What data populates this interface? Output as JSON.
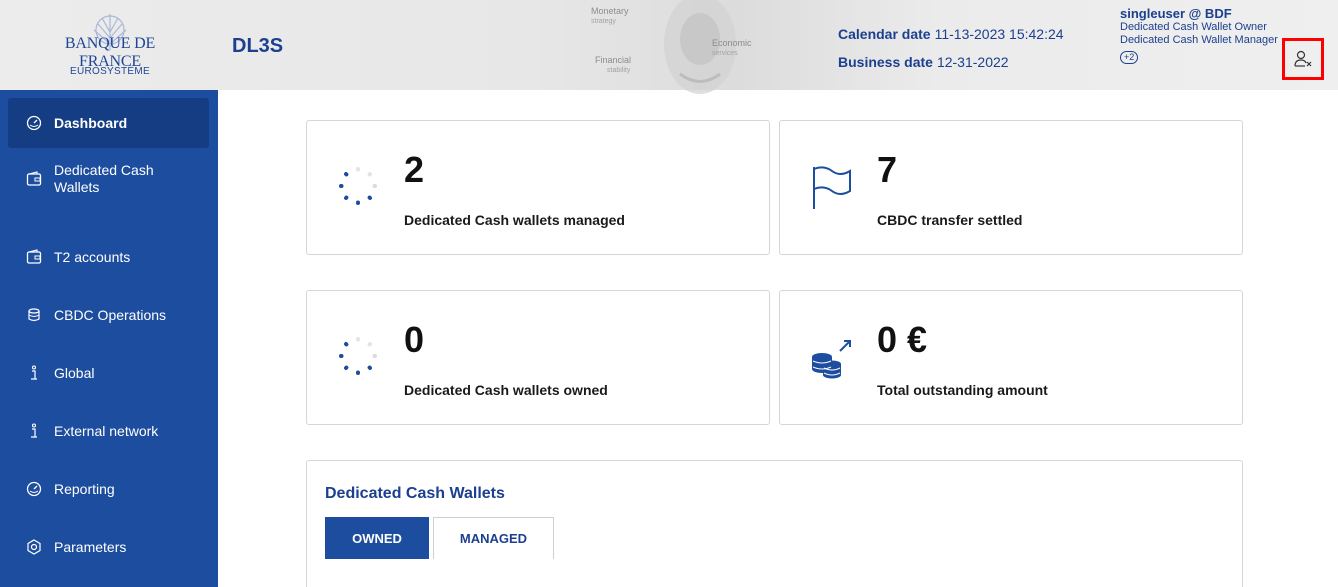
{
  "header": {
    "logo_main": "BANQUE DE FRANCE",
    "logo_sub": "EUROSYSTÈME",
    "app_name": "DL3S",
    "medallion": {
      "monetary": "Monetary",
      "strategy": "strategy",
      "economic": "Economic",
      "services": "services",
      "financial": "Financial",
      "stability": "stability"
    },
    "calendar_label": "Calendar date",
    "calendar_value": "11-13-2023 15:42:24",
    "business_label": "Business date",
    "business_value": "12-31-2022",
    "user": {
      "name": "singleuser @ BDF",
      "roles": [
        "Dedicated Cash Wallet Owner",
        "Dedicated Cash Wallet Manager"
      ],
      "more": "+2",
      "logout_icon": "user-logout-icon"
    }
  },
  "sidebar": {
    "items": [
      {
        "label": "Dashboard",
        "icon": "gauge-icon",
        "active": true
      },
      {
        "label": "Dedicated Cash Wallets",
        "icon": "wallet-icon"
      },
      {
        "label": "T2 accounts",
        "icon": "wallet-icon"
      },
      {
        "label": "CBDC Operations",
        "icon": "coins-icon"
      },
      {
        "label": "Global",
        "icon": "info-icon"
      },
      {
        "label": "External network",
        "icon": "info-icon"
      },
      {
        "label": "Reporting",
        "icon": "gauge-icon"
      },
      {
        "label": "Parameters",
        "icon": "gear-icon"
      }
    ]
  },
  "cards": [
    {
      "value": "2",
      "label": "Dedicated Cash wallets managed",
      "icon": "spinner-icon"
    },
    {
      "value": "7",
      "label": "CBDC transfer settled",
      "icon": "flag-icon"
    },
    {
      "value": "0",
      "label": "Dedicated Cash wallets owned",
      "icon": "spinner-icon"
    },
    {
      "value": "0 €",
      "label": "Total outstanding amount",
      "icon": "coins-arrow-icon"
    }
  ],
  "wallets_panel": {
    "title": "Dedicated Cash Wallets",
    "tabs": [
      {
        "label": "OWNED",
        "active": true
      },
      {
        "label": "MANAGED",
        "active": false
      }
    ]
  },
  "colors": {
    "brand_blue": "#1d4d9e",
    "active_nav": "#143d83",
    "text_blue": "#1c3f8f",
    "highlight_red": "#ff0000"
  }
}
